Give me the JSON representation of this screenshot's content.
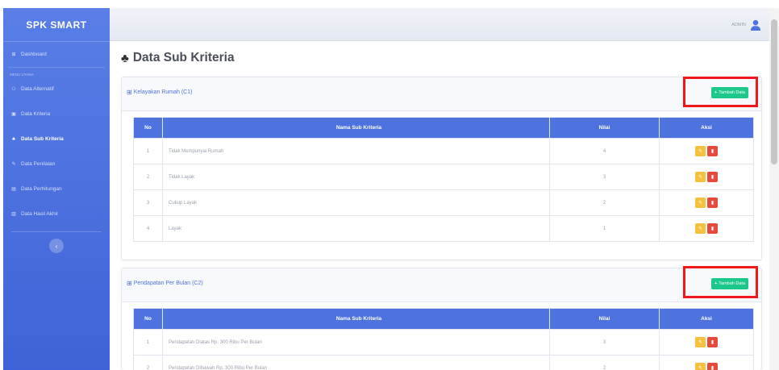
{
  "sidebar": {
    "brand": "SPK SMART",
    "section_heading": "MENU UTAMA",
    "items": [
      {
        "label": "Dashboard",
        "icon": "dashboard-icon",
        "glyph": "⊞",
        "active": false
      },
      {
        "label": "Data Alternatif",
        "icon": "users-icon",
        "glyph": "⚇",
        "active": false
      },
      {
        "label": "Data Kriteria",
        "icon": "cube-icon",
        "glyph": "▣",
        "active": false
      },
      {
        "label": "Data Sub Kriteria",
        "icon": "cubes-icon",
        "glyph": "♣",
        "active": true
      },
      {
        "label": "Data Penilaian",
        "icon": "edit-icon",
        "glyph": "✎",
        "active": false
      },
      {
        "label": "Data Perhitungan",
        "icon": "calculator-icon",
        "glyph": "▤",
        "active": false
      },
      {
        "label": "Data Hasil Akhir",
        "icon": "chart-icon",
        "glyph": "▥",
        "active": false
      }
    ],
    "toggle_glyph": "‹"
  },
  "topbar": {
    "user_name": "ADMIN"
  },
  "page": {
    "title": "Data Sub Kriteria",
    "title_glyph": "♣"
  },
  "columns": {
    "no": "No",
    "name": "Nama Sub Kriteria",
    "value": "Nilai",
    "action": "Aksi"
  },
  "sections": [
    {
      "title": "Kelayakan Rumah (C1)",
      "add_label": "Tambah Data",
      "rows": [
        {
          "no": "1",
          "name": "Tidak Mempunyai Rumah",
          "value": "4"
        },
        {
          "no": "2",
          "name": "Tidak Layak",
          "value": "3"
        },
        {
          "no": "3",
          "name": "Cukup Layak",
          "value": "2"
        },
        {
          "no": "4",
          "name": "Layak",
          "value": "1"
        }
      ]
    },
    {
      "title": "Pendapatan Per Bulan (C2)",
      "add_label": "Tambah Data",
      "rows": [
        {
          "no": "1",
          "name": "Pendapatan Diatas Rp. 300 Ribu Per Bulan",
          "value": "3"
        },
        {
          "no": "2",
          "name": "Pendapatan Dibawah Rp. 300 Ribu Per Bulan",
          "value": "2"
        }
      ]
    }
  ],
  "colors": {
    "sidebar": "#4e73df",
    "table_header": "#4e73df",
    "add_button": "#1cc88a",
    "edit_button": "#f6c23e",
    "delete_button": "#e74a3b",
    "highlight_box": "#f0181a"
  }
}
